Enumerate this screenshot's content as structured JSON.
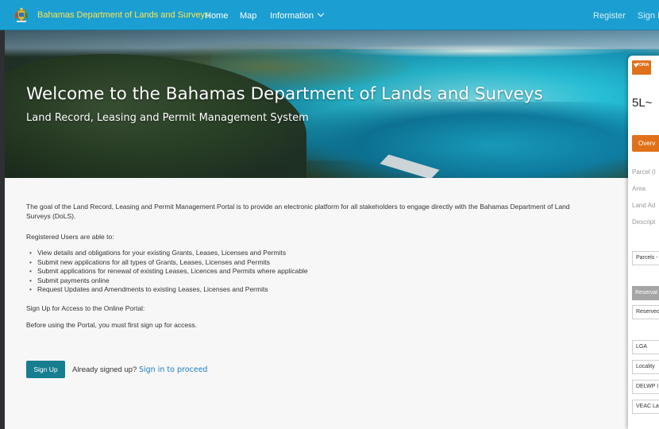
{
  "nav": {
    "brand": "Bahamas Department of Lands and Surveys",
    "items": [
      "Home",
      "Map",
      "Information"
    ],
    "register": "Register",
    "sign_in": "Sign In"
  },
  "hero": {
    "title": "Welcome to the Bahamas Department of Lands and Surveys",
    "subtitle": "Land Record, Leasing and Permit Management System"
  },
  "content": {
    "intro_line1": "The goal of the Land Record, Leasing and Permit Management Portal is to provide an electronic platform for all stakeholders to engage directly with the Bahamas Department of Land",
    "intro_line2": "Surveys (DoLS).",
    "registered_heading": "Registered Users are able to:",
    "bullets": [
      "View details and obligations for your existing Grants, Leases, Licenses and Permits",
      "Submit new applications for all types of Grants, Leases, Licenses and Permits",
      "Submit applications for renewal of existing Leases, Licences and Permits where applicable",
      "Submit payments online",
      "Request Updates and Amendments to existing Leases, Licenses and Permits"
    ],
    "signup_heading": "Sign Up for Access to the Online Portal:",
    "before_text": "Before using the Portal, you must first sign up for access.",
    "signup_button": "Sign Up",
    "already_text": "Already signed up?",
    "signin_link": "Sign in to proceed"
  },
  "panel": {
    "logo_text": "TORIA",
    "title": "5L~",
    "tab": "Overv",
    "labels": [
      "Parcel (I",
      "Area",
      "Land Ad",
      "Descript"
    ],
    "select_parcels": "Parcels -",
    "reserve_header": "Reservat",
    "reserve_value": "Reserved",
    "fields": [
      "LGA",
      "Locality",
      "DELWP I",
      "VEAC La"
    ]
  },
  "colors": {
    "nav_bg": "#1b9fd2",
    "brand_text": "#ffe44d",
    "signup_button": "#167e8f",
    "link": "#1a7fc4",
    "panel_accent": "#e0711b"
  }
}
